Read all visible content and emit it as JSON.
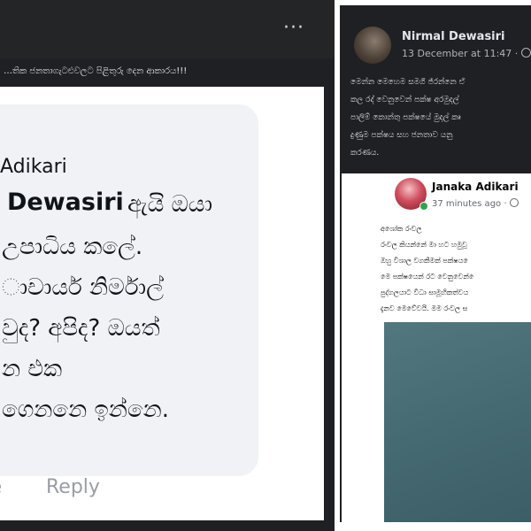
{
  "left_screenshot": {
    "menu_glyph": "···",
    "post_caption": "…තික ජනතාගැටළුවලට පිළිතුරු දෙන ආකාරය!!!",
    "comment": {
      "commenter_name": "Adikari",
      "tagged_name": "Dewasiri",
      "lines": [
        "ඇයි ඔයා",
        "උපාධිය කලේ.",
        "ාචාර්ය නිර්මාල්",
        "වුද? අපිද? ඔයත්",
        "න එක",
        "ගෙනනෙ ඉන්නෙ."
      ]
    },
    "actions": {
      "like": "te",
      "reply": "Reply"
    }
  },
  "right_screenshot": {
    "post": {
      "author": "Nirmal Dewasiri",
      "timestamp": "13 December at 11:47 ·",
      "text_lines": [
        "මෙන්න මෙහෙම සමගි ජ්රන්නෙ ඒ",
        "කල රද් වෙනුවෙන් පක්ෂ අරමුදල්",
        "පාලිම් කොන්තු පක්ෂයේ මුදල් කෘ",
        "දුණුම පක්ෂය සහ ජනතාව යනු",
        "කරණය."
      ]
    },
    "shared_post": {
      "author": "Janaka Adikari",
      "time": "37 minutes ago ·",
      "text_lines": [
        "අශෝක රංවල",
        "රංවල කියන්නේ මා හට හමුවූ",
        "ඔහු විශාල වගකීමක් පක්ෂය ෙ",
        "මෙ පක්ෂයෙන් රට වෙනුවෙන් ෙ",
        "පුද්ගලයාට විධා සාමූහිකත්වය",
        "දැනව මෙවේවයි. මම රංවල ස"
      ]
    }
  }
}
